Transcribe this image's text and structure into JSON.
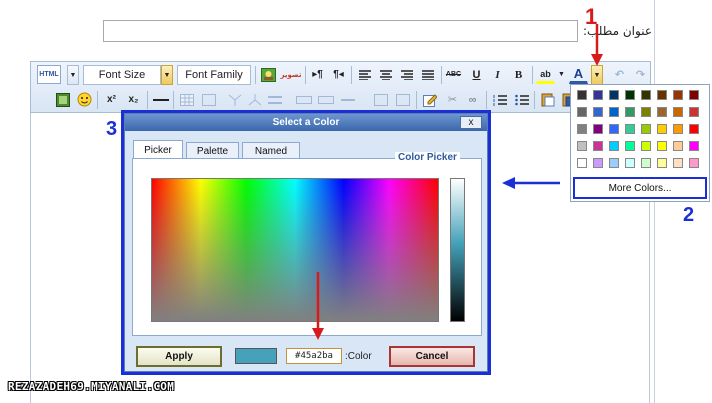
{
  "form": {
    "title_label": "عنوان مطلب:",
    "title_value": ""
  },
  "toolbar": {
    "html_label": "HTML",
    "font_size_label": "Font Size",
    "font_family_label": "Font Family",
    "image_label": "تصویر",
    "ltr_label": "▸¶",
    "rtl_label": "¶◂",
    "abc_label": "ABC",
    "underline_label": "U",
    "italic_label": "I",
    "bold_label": "B",
    "highlight_label": "ab",
    "font_color_label": "A",
    "superscript_label": "x²",
    "subscript_label": "x₂"
  },
  "color_palette": {
    "swatches": [
      [
        "#333333",
        "#333399",
        "#003366",
        "#003300",
        "#333300",
        "#663300",
        "#993300",
        "#800000"
      ],
      [
        "#666666",
        "#3366cc",
        "#0066cc",
        "#339966",
        "#808000",
        "#996633",
        "#cc6600",
        "#cc3333"
      ],
      [
        "#808080",
        "#800080",
        "#3366ff",
        "#33cc99",
        "#99cc00",
        "#ffcc00",
        "#ff9900",
        "#ff0000"
      ],
      [
        "#c0c0c0",
        "#cc3399",
        "#00ccff",
        "#00ff99",
        "#ccff00",
        "#ffff00",
        "#ffcc99",
        "#ff00ff"
      ],
      [
        "#ffffff",
        "#cc99ff",
        "#99ccff",
        "#ccffff",
        "#ccffcc",
        "#ffff99",
        "#ffe0c0",
        "#ff99cc"
      ]
    ],
    "more_colors_label": "More Colors..."
  },
  "dialog": {
    "title": "Select a Color",
    "close_label": "x",
    "tabs": [
      "Picker",
      "Palette",
      "Named"
    ],
    "active_tab": "Picker",
    "picker_legend": "Color Picker",
    "apply_label": "Apply",
    "cancel_label": "Cancel",
    "color_label": ":Color",
    "hex_value": "#45a2ba",
    "preview_color": "#45a2ba"
  },
  "annotations": {
    "step1": "1",
    "step2": "2",
    "step3": "3",
    "arrow_red": "#d91a1a",
    "arrow_blue": "#1b2fd6"
  },
  "watermark": "REZAZADEH69.MIYANALI.COM"
}
